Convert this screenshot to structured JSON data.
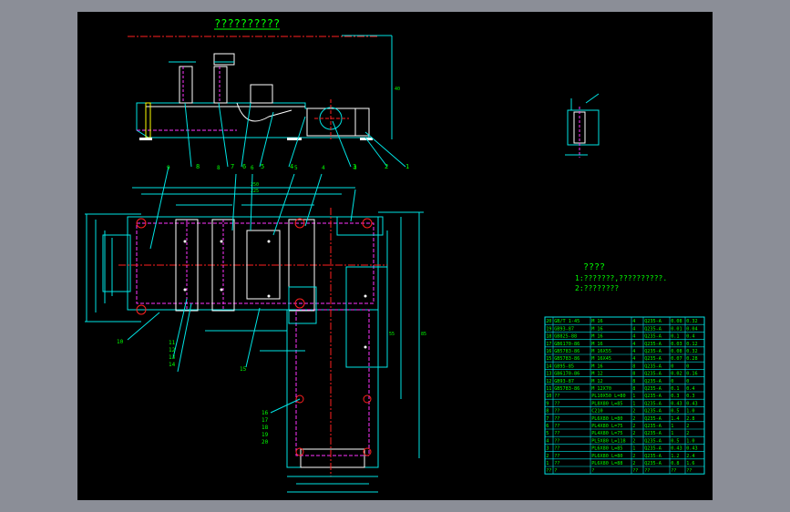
{
  "title": "??????????",
  "notes_header": "????",
  "note_lines": [
    "1:???????,??????????.",
    "2:????????"
  ],
  "callouts_top": [
    "8",
    "7",
    "6",
    "5",
    "4",
    "3",
    "2",
    "1"
  ],
  "callouts_plan_top": [
    "9",
    "8",
    "6",
    "5",
    "4",
    "3"
  ],
  "callouts_left": [
    "10",
    "11",
    "12",
    "13",
    "14",
    "15"
  ],
  "callouts_lower": [
    "16",
    "17",
    "18",
    "19",
    "20"
  ],
  "bom_rows": [
    [
      "20",
      "GB/T 1-45",
      "M 16",
      "4",
      "Q235-A",
      "0.08",
      "0.32"
    ],
    [
      "19",
      "GB93-87",
      "M 16",
      "4",
      "Q235-A",
      "0.01",
      "0.04"
    ],
    [
      "18",
      "GB825-88",
      "M 16",
      "4",
      "Q235-A",
      "0.1",
      "0.4"
    ],
    [
      "17",
      "GB6170-86",
      "M 16",
      "4",
      "Q235-A",
      "0.03",
      "0.12"
    ],
    [
      "16",
      "GB5783-86",
      "M 16X55",
      "4",
      "Q235-A",
      "0.08",
      "0.32"
    ],
    [
      "15",
      "GB5783-86",
      "M 16X45",
      "4",
      "Q235-A",
      "0.07",
      "0.28"
    ],
    [
      "14",
      "GB95-85",
      "M 16",
      "8",
      "Q235-A",
      "0",
      "0"
    ],
    [
      "13",
      "GB6170-86",
      "M 12",
      "8",
      "Q235-A",
      "0.02",
      "0.16"
    ],
    [
      "12",
      "GB93-87",
      "M 12",
      "8",
      "Q235-A",
      "0",
      "0"
    ],
    [
      "11",
      "GB5783-86",
      "M 12X70",
      "8",
      "Q235-A",
      "0.1",
      "0.4"
    ],
    [
      "10",
      "??",
      "PL10X50 L=80",
      "1",
      "Q235-A",
      "0.3",
      "0.3"
    ],
    [
      "9",
      "??",
      "PL8X80 L=85",
      "1",
      "Q235-A",
      "0.43",
      "0.43"
    ],
    [
      "8",
      "??",
      "C210",
      "2",
      "Q235-A",
      "0.5",
      "1.0"
    ],
    [
      "7",
      "??",
      "PL6X80 L=80",
      "2",
      "Q235-A",
      "1.4",
      "2.8"
    ],
    [
      "6",
      "??",
      "PL4X80 L=75",
      "2",
      "Q235-A",
      "1",
      "2"
    ],
    [
      "5",
      "??",
      "PL4X80 L=75",
      "2",
      "Q235-A",
      "1",
      "2"
    ],
    [
      "4",
      "??",
      "PL5X80 L=118",
      "2",
      "Q235-A",
      "0.5",
      "1.0"
    ],
    [
      "3",
      "??",
      "PL6X80 L=85",
      "1",
      "Q235-A",
      "0.43",
      "0.43"
    ],
    [
      "2",
      "??",
      "PL6X80 L=80",
      "2",
      "Q235-A",
      "1.2",
      "2.4"
    ],
    [
      "1",
      "??",
      "PL6X80 L=88",
      "2",
      "Q235-A",
      "0.8",
      "1.6"
    ]
  ],
  "bom_header": [
    "??",
    "?",
    "?",
    "??",
    "??",
    "??",
    "??"
  ],
  "colors": {
    "frame": "#8b8e97",
    "sheet": "#000000",
    "line": "#00e5e5",
    "hidden": "#ff33ff",
    "center": "#ff2020",
    "text": "#00ff00",
    "white": "#ffffff"
  }
}
